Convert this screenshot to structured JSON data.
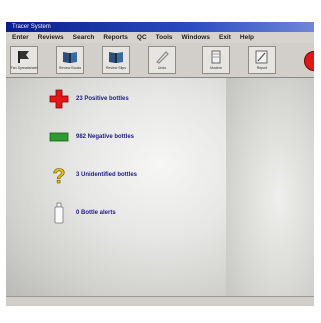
{
  "window": {
    "title": "Tracer System"
  },
  "menu": [
    "Enter",
    "Reviews",
    "Search",
    "Reports",
    "QC",
    "Tools",
    "Windows",
    "Exit",
    "Help"
  ],
  "toolbar": {
    "buttons": [
      {
        "label": "Fan Spreadsheet",
        "icon": "flag-icon"
      },
      {
        "label": "Review Books",
        "icon": "book-icon"
      },
      {
        "label": "Review Slips",
        "icon": "book-icon"
      },
      {
        "label": "Undo",
        "icon": "pen-icon"
      },
      {
        "label": "Modem",
        "icon": "document-icon"
      },
      {
        "label": "Report",
        "icon": "edit-icon"
      }
    ],
    "stop_icon": "stop-icon"
  },
  "legend": [
    {
      "text": "23 Positive bottles",
      "icon": "red-cross-icon"
    },
    {
      "text": "982 Negative bottles",
      "icon": "green-bar-icon"
    },
    {
      "text": "3 Unidentified bottles",
      "icon": "question-mark-icon"
    },
    {
      "text": "0 Bottle alerts",
      "icon": "bottle-icon"
    }
  ],
  "colors": {
    "positive": "#e01818",
    "negative": "#2f9a2f",
    "unidentified": "#e6c100",
    "accent": "#0a1f8a"
  }
}
